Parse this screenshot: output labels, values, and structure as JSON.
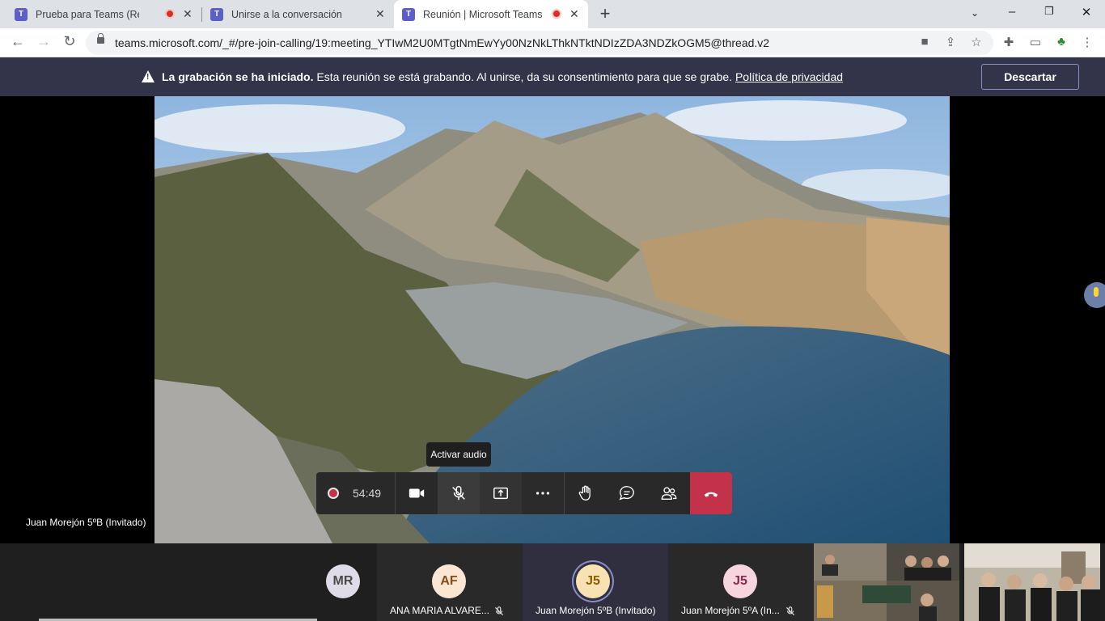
{
  "browser": {
    "tabs": [
      {
        "title": "Prueba para Teams (Reunión",
        "recording": true,
        "active": false
      },
      {
        "title": "Unirse a la conversación",
        "recording": false,
        "active": false
      },
      {
        "title": "Reunión | Microsoft Teams",
        "recording": true,
        "active": true
      }
    ],
    "tab_icon": "teams-logo-icon",
    "url": "teams.microsoft.com/_#/pre-join-calling/19:meeting_YTIwM2U0MTgtNmEwYy00NzNkLThkNTktNDIzZDA3NDZkOGM5@thread.v2"
  },
  "banner": {
    "bold": "La grabación se ha iniciado.",
    "text": "Esta reunión se está grabando. Al unirse, da su consentimiento para que se grabe.",
    "link": "Política de privacidad",
    "dismiss": "Descartar"
  },
  "stage": {
    "speaker_label": "Juan Morejón 5ºB (Invitado)",
    "tooltip": "Activar audio"
  },
  "controls": {
    "timer": "54:49",
    "icons": [
      "record-indicator-icon",
      "camera-icon",
      "microphone-off-icon",
      "share-screen-icon",
      "more-icon",
      "raise-hand-icon",
      "chat-icon",
      "participants-icon",
      "hang-up-icon"
    ],
    "colors": {
      "bar": "#292929",
      "hangup": "#c4314b"
    }
  },
  "participants": [
    {
      "initials": "MR",
      "name": "",
      "avatar_bg": "#e0dbe8",
      "avatar_fg": "#4a4a4a"
    },
    {
      "initials": "AF",
      "name": "ANA MARIA ALVARE...",
      "avatar_bg": "#fbe6d3",
      "avatar_fg": "#8a4b1a",
      "muted": true
    },
    {
      "initials": "J5",
      "name": "Juan Morejón 5ºB (Invitado)",
      "avatar_bg": "#f8e2b4",
      "avatar_fg": "#8a5a00",
      "speaking": true
    },
    {
      "initials": "J5",
      "name": "Juan Morejón 5ºA (In...",
      "avatar_bg": "#f6d5de",
      "avatar_fg": "#8a2a4a",
      "muted": true
    }
  ],
  "theme": {
    "banner_bg": "#33344a",
    "accent": "#5b5fc7"
  }
}
